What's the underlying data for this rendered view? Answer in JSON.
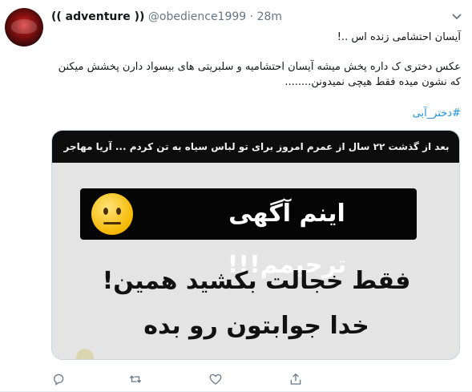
{
  "tweet": {
    "display_name": "(( adventure ))",
    "handle": "@obedience1999",
    "separator": "·",
    "time": "28m",
    "text_line1": "آیسان احتشامی زنده اس ..!",
    "text_line2": "عکس دختری ک داره پخش میشه آیسان احتشامیه و سلبریتی های بیسواد دارن پخشش میکنن که نشون میده فقط هیچی نمیدونن........",
    "hashtag": "#دختر_آبی"
  },
  "media": {
    "top_strip": "بعد از گذشت ۲۲ سال از عمرم امروز برای تو لباس سیاه به تن کردم ... آریا مهاجر",
    "banner": "اینم آگهی ترحیمم!!!",
    "line1": "فقط خجالت بکشید همین!",
    "line2": "خدا جوابتون رو بده",
    "line3": "..."
  },
  "actions": {
    "reply_icon": "reply-icon",
    "retweet_icon": "retweet-icon",
    "like_icon": "heart-icon",
    "share_icon": "share-icon"
  },
  "colors": {
    "link": "#1b95e0",
    "muted": "#657786",
    "text": "#14171a"
  }
}
